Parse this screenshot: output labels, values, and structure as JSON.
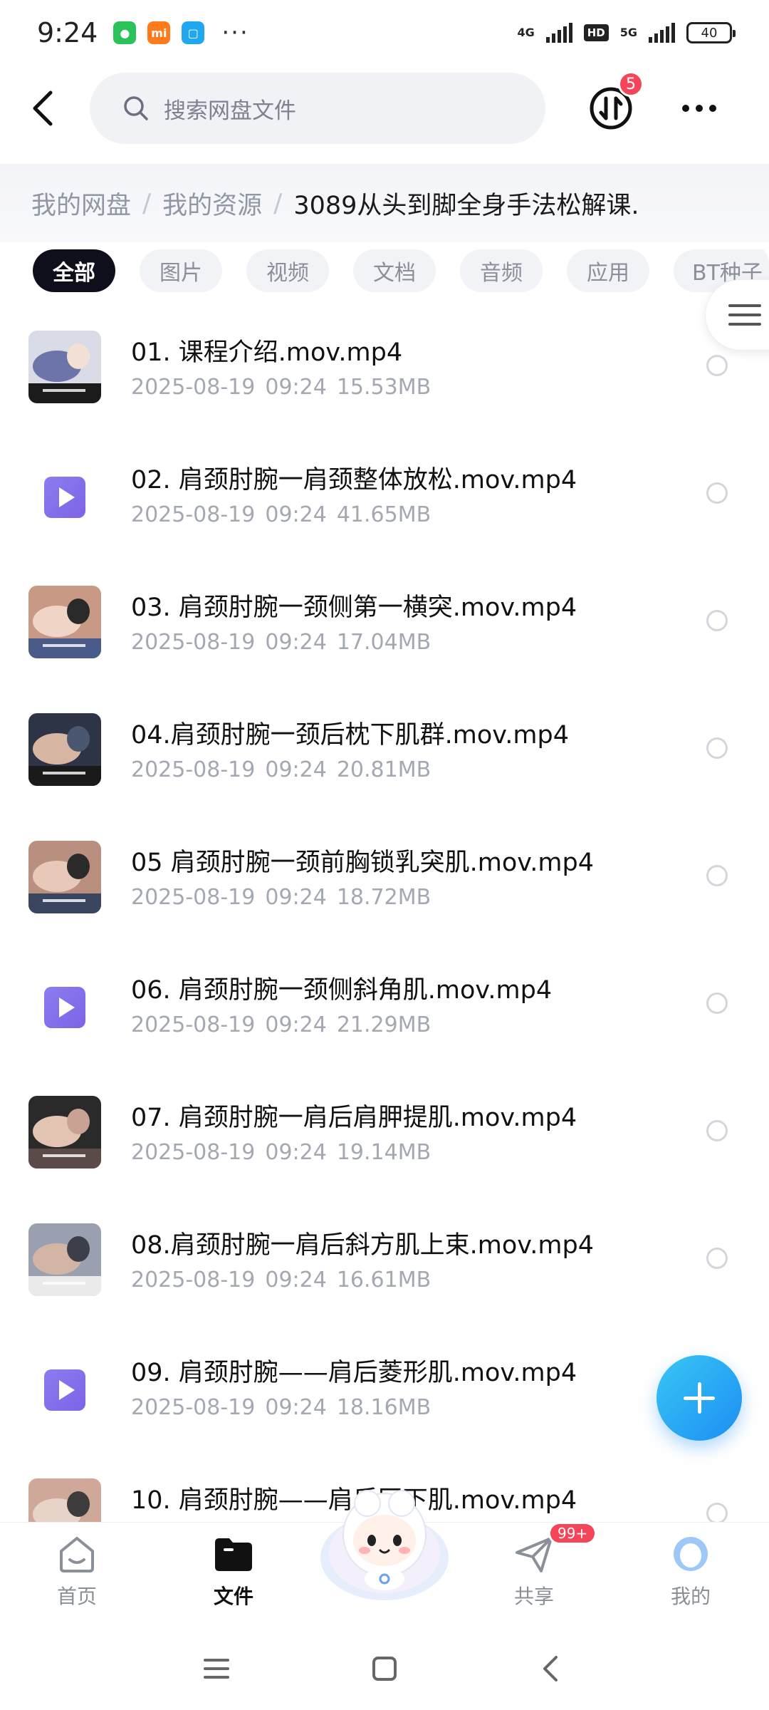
{
  "status_bar": {
    "time": "9:24",
    "dots": "···",
    "network1": "4G",
    "hd": "HD",
    "network2": "5G",
    "battery": "40"
  },
  "header": {
    "search_placeholder": "搜索网盘文件",
    "transfer_badge": "5"
  },
  "breadcrumb": {
    "items": [
      "我的网盘",
      "我的资源",
      "3089从头到脚全身手法松解课."
    ]
  },
  "tabs": [
    "全部",
    "图片",
    "视频",
    "文档",
    "音频",
    "应用",
    "BT种子"
  ],
  "files": [
    {
      "name": "01. 课程介绍.mov.mp4",
      "date": "2025-08-19",
      "time": "09:24",
      "size": "15.53MB",
      "thumb": "photo"
    },
    {
      "name": "02. 肩颈肘腕一肩颈整体放松.mov.mp4",
      "date": "2025-08-19",
      "time": "09:24",
      "size": "41.65MB",
      "thumb": "play"
    },
    {
      "name": "03. 肩颈肘腕一颈侧第一横突.mov.mp4",
      "date": "2025-08-19",
      "time": "09:24",
      "size": "17.04MB",
      "thumb": "photo"
    },
    {
      "name": "04.肩颈肘腕一颈后枕下肌群.mov.mp4",
      "date": "2025-08-19",
      "time": "09:24",
      "size": "20.81MB",
      "thumb": "photo"
    },
    {
      "name": "05 肩颈肘腕一颈前胸锁乳突肌.mov.mp4",
      "date": "2025-08-19",
      "time": "09:24",
      "size": "18.72MB",
      "thumb": "photo"
    },
    {
      "name": "06. 肩颈肘腕一颈侧斜角肌.mov.mp4",
      "date": "2025-08-19",
      "time": "09:24",
      "size": "21.29MB",
      "thumb": "play"
    },
    {
      "name": "07. 肩颈肘腕一肩后肩胛提肌.mov.mp4",
      "date": "2025-08-19",
      "time": "09:24",
      "size": "19.14MB",
      "thumb": "photo"
    },
    {
      "name": "08.肩颈肘腕一肩后斜方肌上束.mov.mp4",
      "date": "2025-08-19",
      "time": "09:24",
      "size": "16.61MB",
      "thumb": "photo"
    },
    {
      "name": "09. 肩颈肘腕——肩后菱形肌.mov.mp4",
      "date": "2025-08-19",
      "time": "09:24",
      "size": "18.16MB",
      "thumb": "play"
    },
    {
      "name": "10. 肩颈肘腕——肩后冈下肌.mov.mp4",
      "date": "",
      "time": "",
      "size": "",
      "thumb": "photo"
    }
  ],
  "bottom_nav": {
    "home": "首页",
    "files": "文件",
    "share": "共享",
    "share_badge": "99+",
    "me": "我的"
  },
  "colors": {
    "accent": "#1c8ef2",
    "video_icon": "#7e63e6",
    "badge": "#f4455a"
  }
}
